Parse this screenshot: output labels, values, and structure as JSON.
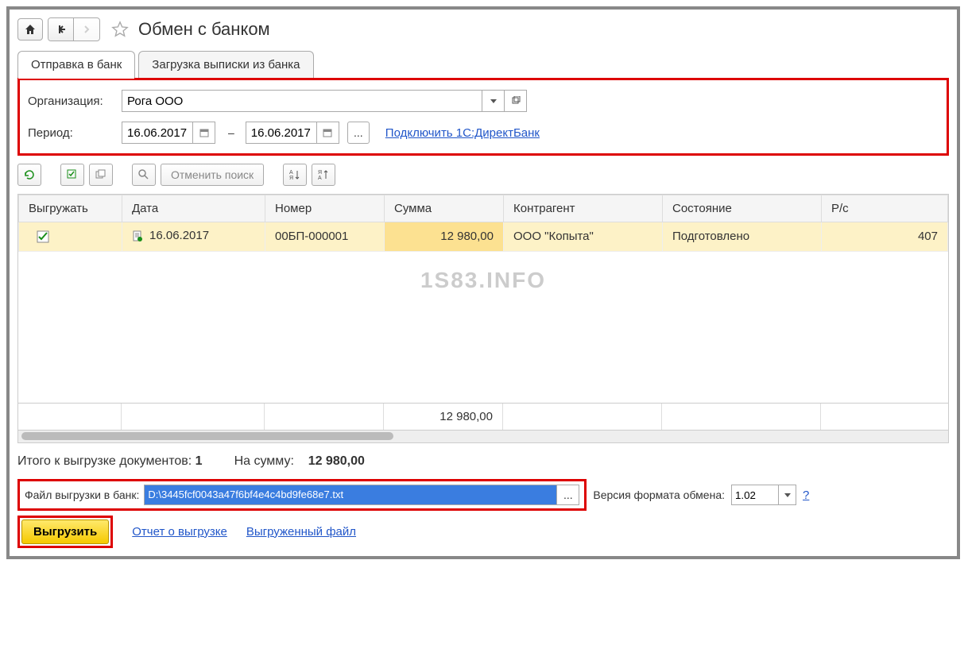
{
  "title": "Обмен с банком",
  "tabs": [
    "Отправка в банк",
    "Загрузка выписки из банка"
  ],
  "form": {
    "org_label": "Организация:",
    "org_value": "Рога ООО",
    "period_label": "Период:",
    "date_from": "16.06.2017",
    "date_to": "16.06.2017",
    "connect_link": "Подключить 1С:ДиректБанк"
  },
  "toolbar": {
    "cancel_search": "Отменить поиск"
  },
  "table": {
    "headers": [
      "Выгружать",
      "Дата",
      "Номер",
      "Сумма",
      "Контрагент",
      "Состояние",
      "Р/с"
    ],
    "row": {
      "date": "16.06.2017",
      "number": "00БП-000001",
      "sum": "12 980,00",
      "agent": "ООО \"Копыта\"",
      "status": "Подготовлено",
      "account": "407"
    },
    "footer_sum": "12 980,00"
  },
  "watermark": "1S83.INFO",
  "summary": {
    "docs_label": "Итого к выгрузке документов:",
    "docs_count": "1",
    "sum_label": "На сумму:",
    "sum_value": "12 980,00"
  },
  "file": {
    "label": "Файл выгрузки в банк:",
    "value": "D:\\3445fcf0043a47f6bf4e4c4bd9fe68e7.txt",
    "version_label": "Версия формата обмена:",
    "version_value": "1.02"
  },
  "actions": {
    "export": "Выгрузить",
    "report": "Отчет о выгрузке",
    "exported_file": "Выгруженный файл"
  }
}
